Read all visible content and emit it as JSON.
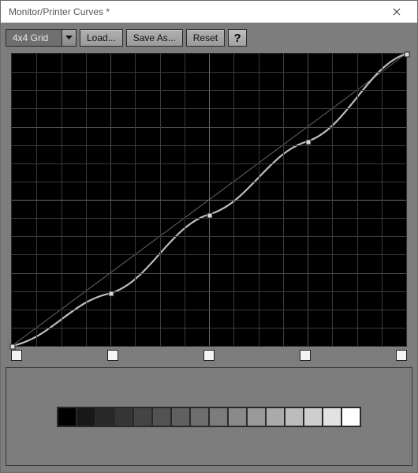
{
  "window": {
    "title": "Monitor/Printer Curves *"
  },
  "toolbar": {
    "grid_dropdown": {
      "selected": "4x4 Grid"
    },
    "load_label": "Load...",
    "save_as_label": "Save As...",
    "reset_label": "Reset",
    "help_label": "?"
  },
  "curve": {
    "nodes": [
      {
        "x": 0.0,
        "y": 0.0
      },
      {
        "x": 0.25,
        "y": 0.18
      },
      {
        "x": 0.5,
        "y": 0.45
      },
      {
        "x": 0.75,
        "y": 0.7
      },
      {
        "x": 1.0,
        "y": 1.0
      }
    ]
  },
  "swatches": {
    "count": 16,
    "colors": [
      "#000000",
      "#181818",
      "#282828",
      "#363636",
      "#444444",
      "#525252",
      "#606060",
      "#6e6e6e",
      "#7c7c7c",
      "#8a8a8a",
      "#9a9a9a",
      "#aaaaaa",
      "#bcbcbc",
      "#cecece",
      "#e2e2e2",
      "#ffffff"
    ]
  },
  "ticks": {
    "count": 5
  }
}
